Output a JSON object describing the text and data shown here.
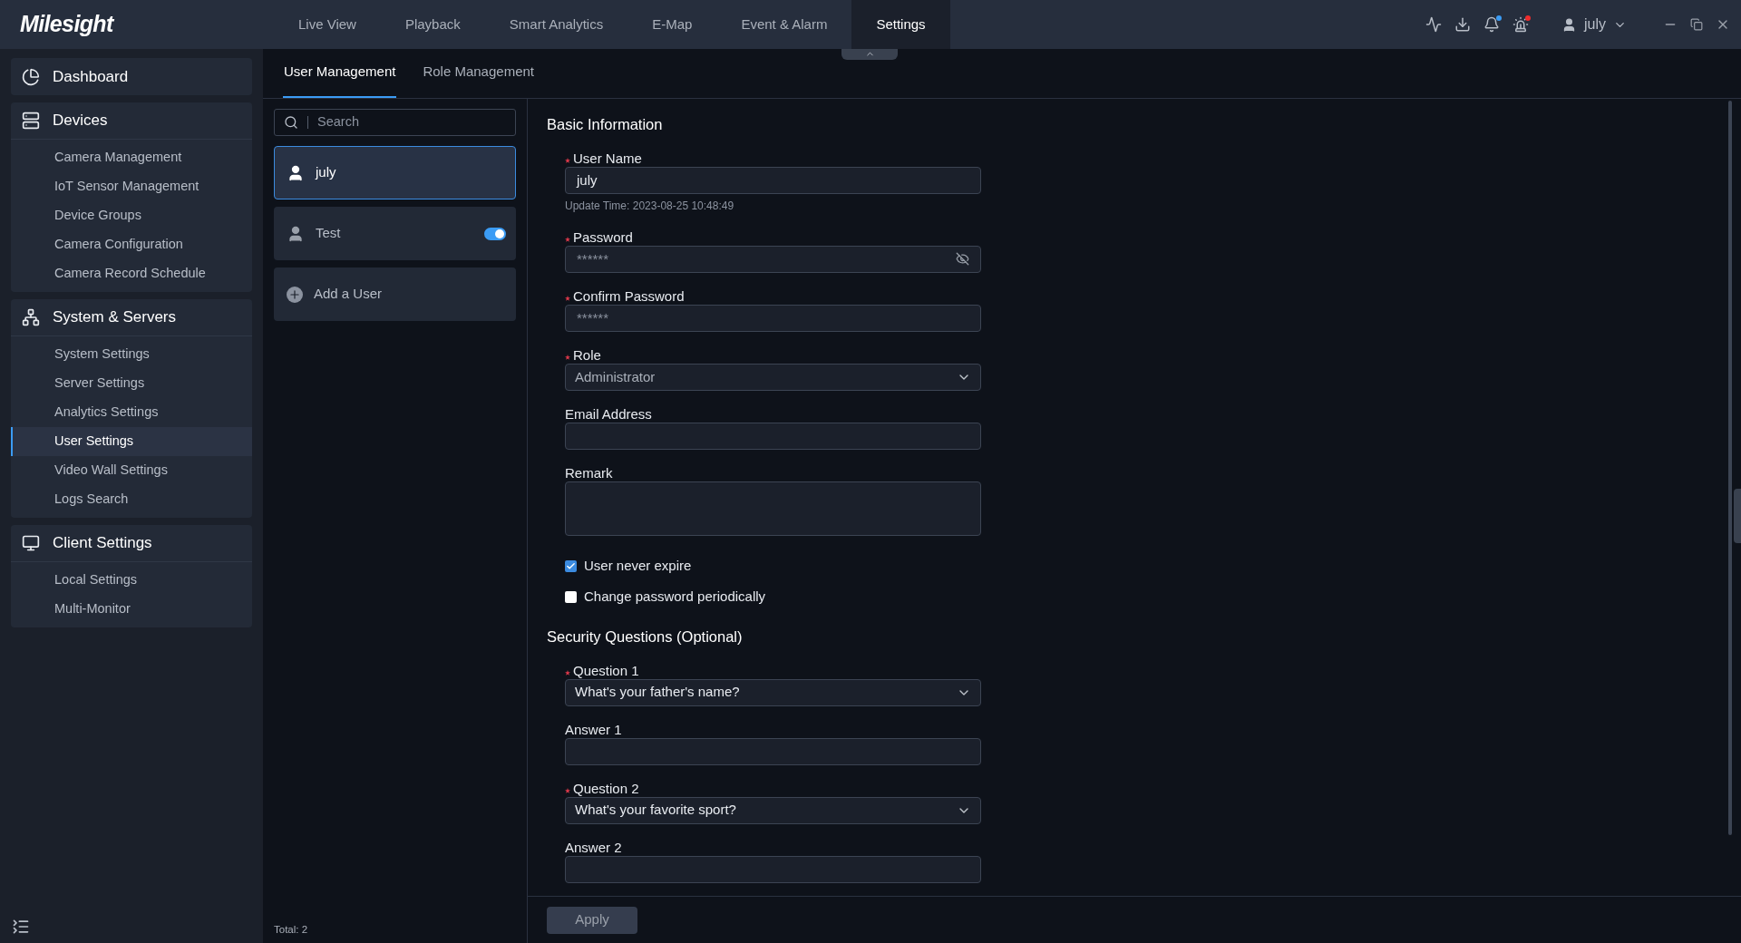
{
  "app": {
    "logo": "Milesight"
  },
  "nav": [
    {
      "label": "Live View",
      "selected": false
    },
    {
      "label": "Playback",
      "selected": false
    },
    {
      "label": "Smart Analytics",
      "selected": false
    },
    {
      "label": "E-Map",
      "selected": false
    },
    {
      "label": "Event & Alarm",
      "selected": false
    },
    {
      "label": "Settings",
      "selected": true
    }
  ],
  "toolbar": [
    {
      "kind": "monitor"
    },
    {
      "kind": "download"
    },
    {
      "kind": "bell",
      "color": "#3b9cf5"
    },
    {
      "kind": "alarm",
      "color": "#f02c2c"
    }
  ],
  "user_menu": {
    "name": "july"
  },
  "sidebar": [
    {
      "kind": "dashboard",
      "label": "Dashboard"
    },
    {
      "kind": "devices",
      "label": "Devices",
      "items": [
        {
          "label": "Camera Management",
          "selected": false
        },
        {
          "label": "IoT Sensor Management",
          "selected": false
        },
        {
          "label": "Device Groups",
          "selected": false
        },
        {
          "label": "Camera Configuration",
          "selected": false
        },
        {
          "label": "Camera Record Schedule",
          "selected": false
        }
      ]
    },
    {
      "kind": "system",
      "label": "System & Servers",
      "items": [
        {
          "label": "System Settings",
          "selected": false
        },
        {
          "label": "Server Settings",
          "selected": false
        },
        {
          "label": "Analytics Settings",
          "selected": false
        },
        {
          "label": "User Settings",
          "selected": true
        },
        {
          "label": "Video Wall Settings",
          "selected": false
        },
        {
          "label": "Logs Search",
          "selected": false
        }
      ]
    },
    {
      "kind": "client",
      "label": "Client Settings",
      "items": [
        {
          "label": "Local Settings",
          "selected": false
        },
        {
          "label": "Multi-Monitor",
          "selected": false
        }
      ]
    }
  ],
  "tabs": [
    {
      "label": "User Management",
      "selected": true
    },
    {
      "label": "Role Management",
      "selected": false
    }
  ],
  "search": {
    "placeholder": "Search"
  },
  "users": [
    {
      "kind": "admin",
      "name": "july",
      "selected": true
    },
    {
      "kind": "user",
      "name": "Test",
      "selected": false,
      "on": true
    },
    {
      "kind": "add",
      "name": "Add a User",
      "selected": false
    }
  ],
  "total": "Total: 2",
  "sections": [
    {
      "title": "Basic Information",
      "fields": [
        {
          "kind": "text",
          "label": "User Name",
          "required": true,
          "value": "july",
          "note": "Update Time: 2023-08-25 10:48:49"
        },
        {
          "kind": "password",
          "label": "Password",
          "required": true,
          "value": "******"
        },
        {
          "kind": "masked",
          "label": "Confirm Password",
          "required": true,
          "value": "******"
        },
        {
          "kind": "select",
          "label": "Role",
          "required": true,
          "value": "Administrator"
        },
        {
          "kind": "text",
          "label": "Email Address",
          "required": false
        },
        {
          "kind": "textarea",
          "label": "Remark",
          "required": false
        }
      ],
      "checkboxes": [
        {
          "label": "User never expire",
          "checked": true
        },
        {
          "label": "Change password periodically",
          "checked": false
        }
      ]
    },
    {
      "title": "Security Questions (Optional)",
      "fields": [
        {
          "kind": "select",
          "label": "Question 1",
          "required": true,
          "value": "What's your father's name?"
        },
        {
          "kind": "text",
          "label": "Answer 1",
          "required": false
        },
        {
          "kind": "select",
          "label": "Question 2",
          "required": true,
          "value": "What's your favorite sport?"
        },
        {
          "kind": "text",
          "label": "Answer 2",
          "required": false
        }
      ]
    }
  ],
  "apply": "Apply"
}
